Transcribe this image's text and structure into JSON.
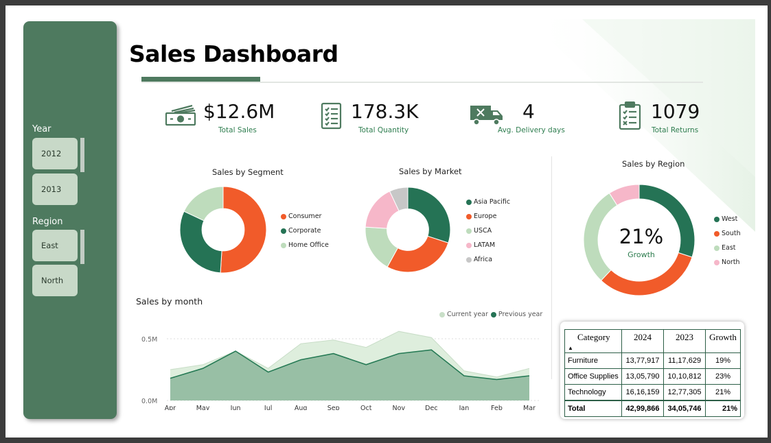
{
  "dashboard": {
    "title": "Sales Dashboard"
  },
  "colors": {
    "dark_green": "#257355",
    "orange": "#f15b2a",
    "light_green": "#bedcbc",
    "pink": "#f6b7c9",
    "gray": "#c7c7c7",
    "sidebar": "#4e7a5f",
    "accent_text": "#2e7d4f",
    "area_current": "#deeedd",
    "area_previous": "#98bfa5",
    "area_previous_line": "#267a55"
  },
  "filters": {
    "year": {
      "label": "Year",
      "options": [
        "2012",
        "2013"
      ]
    },
    "region": {
      "label": "Region",
      "options": [
        "East",
        "North"
      ]
    }
  },
  "kpis": [
    {
      "value": "$12.6M",
      "label": "Total Sales",
      "icon": "money-icon"
    },
    {
      "value": "178.3K",
      "label": "Total Quantity",
      "icon": "checklist-icon"
    },
    {
      "value": "4",
      "label": "Avg. Delivery days",
      "icon": "delivery-truck-icon"
    },
    {
      "value": "1079",
      "label": "Total Returns",
      "icon": "clipboard-icon"
    }
  ],
  "chart_data": [
    {
      "type": "pie",
      "title": "Sales by Segment",
      "categories": [
        "Consumer",
        "Corporate",
        "Home Office"
      ],
      "values": [
        51,
        31,
        18
      ],
      "colors": [
        "#f15b2a",
        "#257355",
        "#bedcbc"
      ]
    },
    {
      "type": "pie",
      "title": "Sales by Market",
      "categories": [
        "Asia Pacific",
        "Europe",
        "USCA",
        "LATAM",
        "Africa"
      ],
      "values": [
        30,
        28,
        18,
        17,
        7
      ],
      "colors": [
        "#257355",
        "#f15b2a",
        "#bedcbc",
        "#f6b7c9",
        "#c7c7c7"
      ]
    },
    {
      "type": "pie",
      "title": "Sales by Region",
      "categories": [
        "West",
        "South",
        "East",
        "North"
      ],
      "values": [
        30,
        32,
        29,
        9
      ],
      "colors": [
        "#257355",
        "#f15b2a",
        "#bedcbc",
        "#f6b7c9"
      ],
      "center_value": "21%",
      "center_label": "Growth"
    },
    {
      "type": "area",
      "title": "Sales by month",
      "x": [
        "Apr",
        "May",
        "Jun",
        "Jul",
        "Aug",
        "Sep",
        "Oct",
        "Nov",
        "Dec",
        "Jan",
        "Feb",
        "Mar"
      ],
      "series": [
        {
          "name": "Current year",
          "values": [
            0.25,
            0.29,
            0.4,
            0.26,
            0.46,
            0.49,
            0.43,
            0.56,
            0.51,
            0.24,
            0.19,
            0.26
          ]
        },
        {
          "name": "Previous year",
          "values": [
            0.18,
            0.26,
            0.4,
            0.23,
            0.33,
            0.38,
            0.29,
            0.38,
            0.41,
            0.2,
            0.17,
            0.2
          ]
        }
      ],
      "yticks": [
        "0.0M",
        "0.5M"
      ],
      "ylim": [
        0,
        0.7
      ]
    },
    {
      "type": "table",
      "columns": [
        "Category",
        "2024",
        "2023",
        "Growth"
      ],
      "rows": [
        [
          "Furniture",
          "13,77,917",
          "11,17,629",
          "19%"
        ],
        [
          "Office Supplies",
          "13,05,790",
          "10,10,812",
          "23%"
        ],
        [
          "Technology",
          "16,16,159",
          "12,77,305",
          "21%"
        ]
      ],
      "total": [
        "Total",
        "42,99,866",
        "34,05,746",
        "21%"
      ]
    }
  ]
}
